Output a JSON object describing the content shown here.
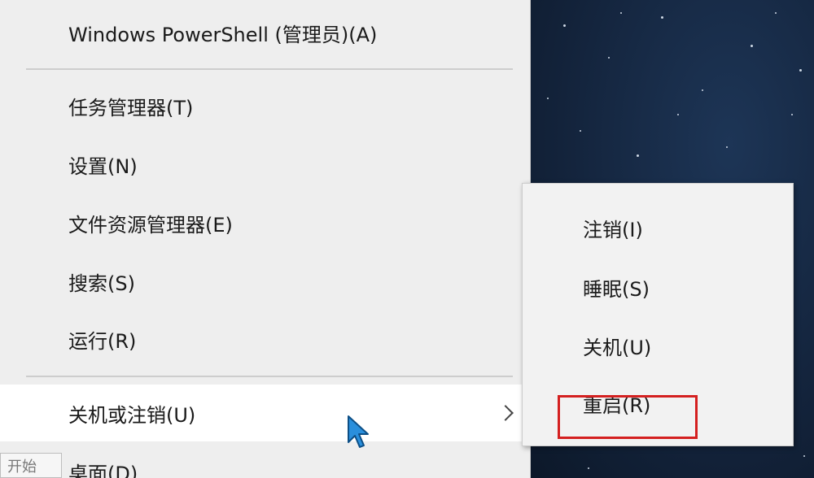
{
  "menu": {
    "items": [
      {
        "label": "Windows PowerShell (管理员)(A)"
      },
      {
        "label": "任务管理器(T)"
      },
      {
        "label": "设置(N)"
      },
      {
        "label": "文件资源管理器(E)"
      },
      {
        "label": "搜索(S)"
      },
      {
        "label": "运行(R)"
      },
      {
        "label": "关机或注销(U)"
      },
      {
        "label": "桌面(D)"
      }
    ]
  },
  "submenu": {
    "items": [
      {
        "label": "注销(I)"
      },
      {
        "label": "睡眠(S)"
      },
      {
        "label": "关机(U)"
      },
      {
        "label": "重启(R)"
      }
    ]
  },
  "start_tooltip": "开始",
  "colors": {
    "menu_bg": "#eeeeee",
    "hover_bg": "#ffffff",
    "highlight_border": "#d42020",
    "cursor": "#2a8fdc"
  }
}
